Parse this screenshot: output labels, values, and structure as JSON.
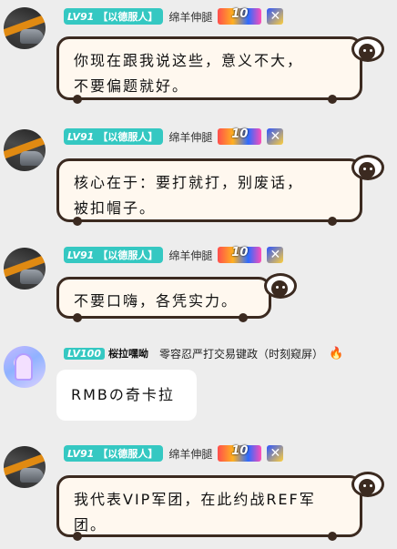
{
  "messages": [
    {
      "level": "LV91",
      "tag": "【以德服人】",
      "name": "绵羊伸腿",
      "medal_label": "10",
      "badge_icon": "x-emblem",
      "text": "你现在跟我说这些，意义不大，\n不要偏题就好。"
    },
    {
      "level": "LV91",
      "tag": "【以德服人】",
      "name": "绵羊伸腿",
      "medal_label": "10",
      "badge_icon": "x-emblem",
      "text": "核心在于：要打就打，别废话，\n被扣帽子。"
    },
    {
      "level": "LV91",
      "tag": "【以德服人】",
      "name": "绵羊伸腿",
      "medal_label": "10",
      "badge_icon": "x-emblem",
      "text": "不要口嗨，各凭实力。"
    },
    {
      "level": "LV100",
      "tag": "桜拉嘿呦",
      "title": "零容忍严打交易键政（时刻窥屏）",
      "icon": "fire-icon",
      "text": "RMBの奇卡拉"
    },
    {
      "level": "LV91",
      "tag": "【以德服人】",
      "name": "绵羊伸腿",
      "medal_label": "10",
      "badge_icon": "x-emblem",
      "text": "我代表VIP军团，在此约战REF军\n团。"
    }
  ],
  "colors": {
    "background": "#ededed",
    "badge": "#35c8c2",
    "bubble_fill": "#fff8ef",
    "bubble_border": "#3b2a20"
  }
}
